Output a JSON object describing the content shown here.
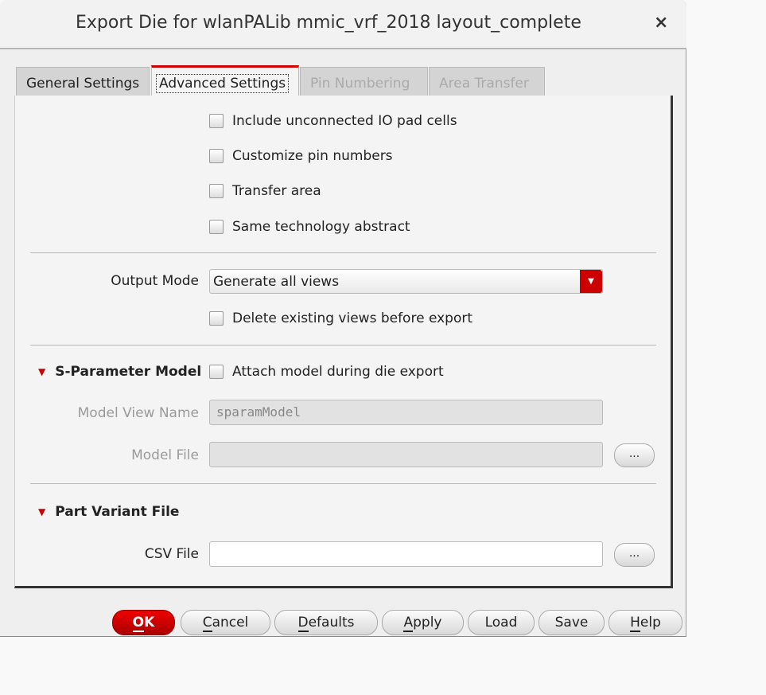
{
  "window": {
    "title": "Export Die for wlanPALib mmic_vrf_2018 layout_complete",
    "close": "×"
  },
  "tabs": [
    {
      "label": "General Settings"
    },
    {
      "label": "Advanced Settings"
    },
    {
      "label": "Pin Numbering"
    },
    {
      "label": "Area Transfer"
    }
  ],
  "checkboxes": {
    "unconnected": "Include unconnected IO pad cells",
    "customize": "Customize pin numbers",
    "transfer": "Transfer area",
    "same_tech": "Same technology abstract",
    "delete_views": "Delete existing views before export",
    "attach_model": "Attach model during die export"
  },
  "output_mode": {
    "label": "Output Mode",
    "value": "Generate all views"
  },
  "sparam": {
    "title": "S-Parameter Model",
    "view_name_label": "Model View Name",
    "view_name_value": "sparamModel",
    "file_label": "Model File",
    "file_value": "",
    "browse": "..."
  },
  "part_variant": {
    "title": "Part Variant File",
    "csv_label": "CSV File",
    "csv_value": "",
    "browse": "..."
  },
  "buttons": {
    "ok": {
      "u": "O",
      "rest": "K"
    },
    "cancel": {
      "u": "C",
      "rest": "ancel"
    },
    "defaults": {
      "u": "D",
      "rest": "efaults"
    },
    "apply": {
      "u": "A",
      "rest": "pply"
    },
    "load": "Load",
    "save": "Save",
    "help": {
      "u": "H",
      "rest": "elp"
    }
  }
}
